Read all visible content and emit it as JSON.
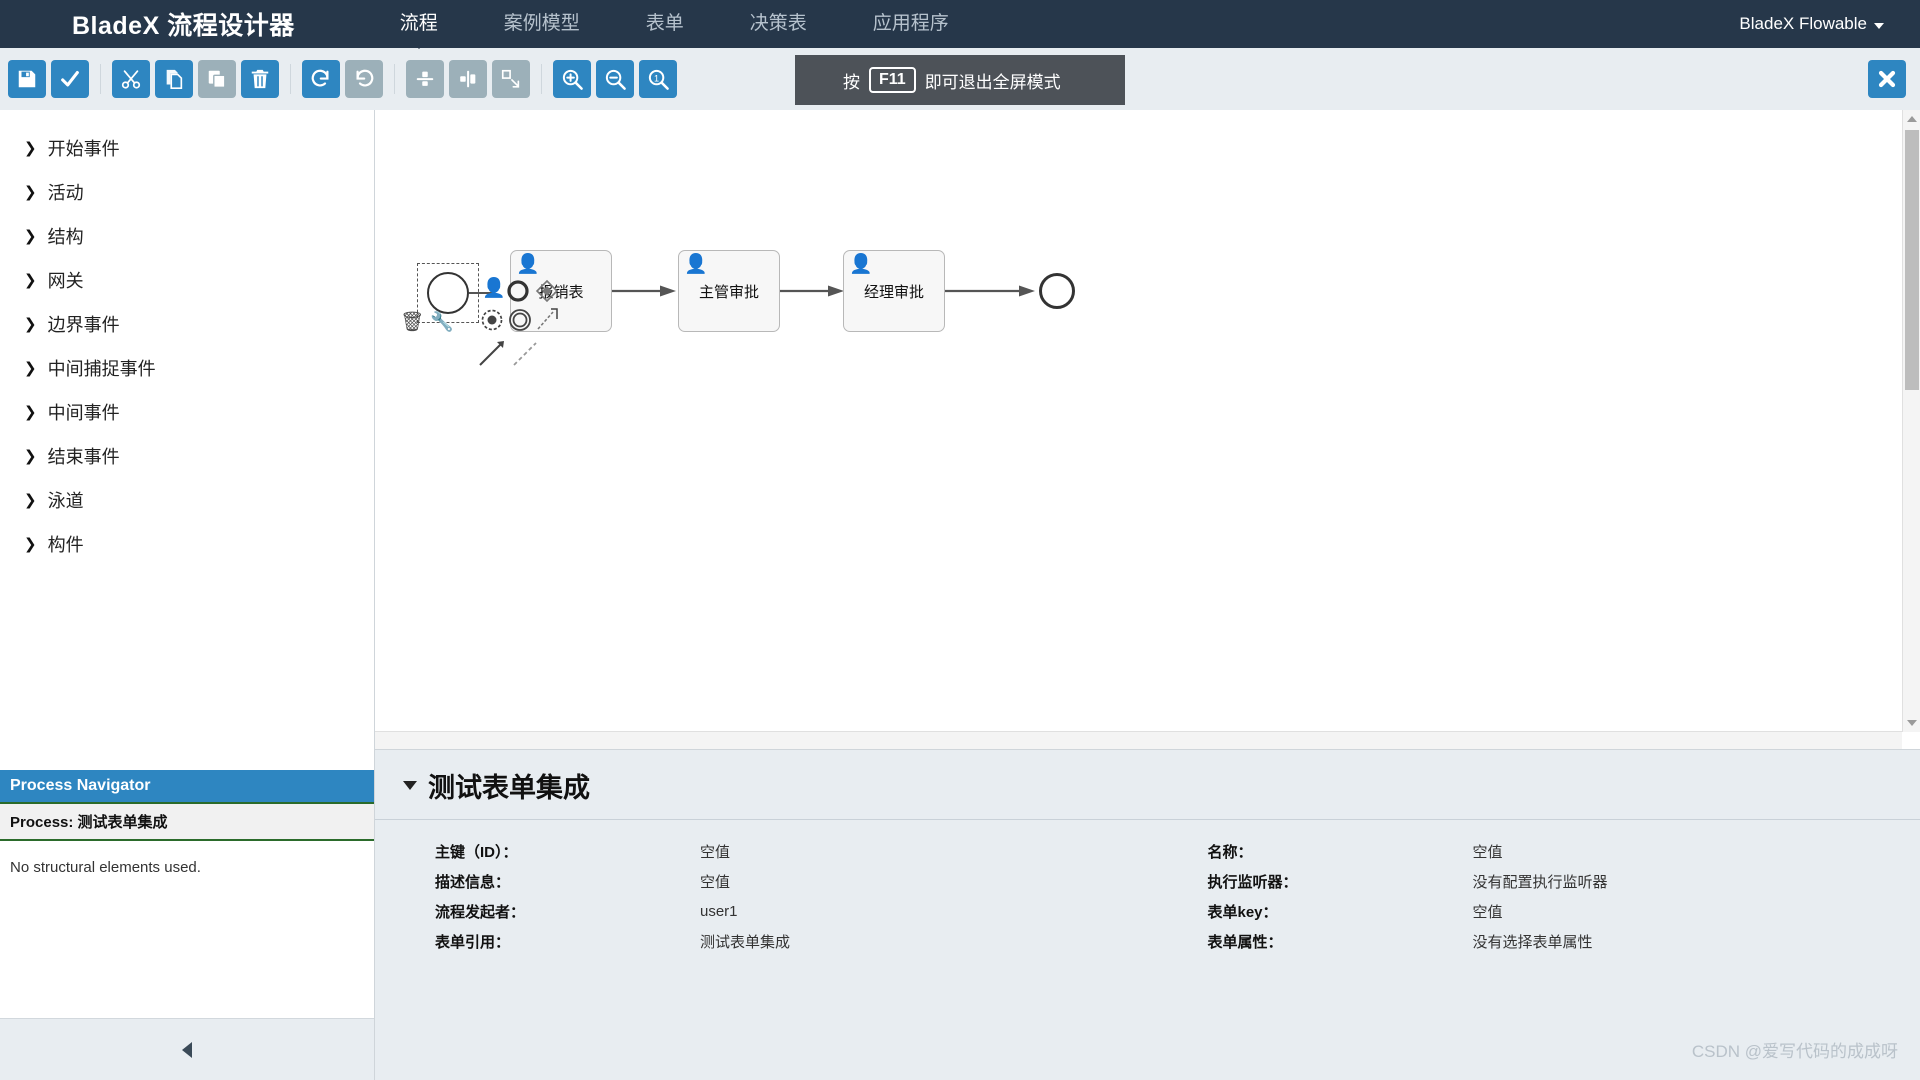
{
  "app": {
    "brand": "BladeX 流程设计器",
    "account": "BladeX Flowable"
  },
  "nav": {
    "tabs": [
      {
        "label": "流程",
        "active": true
      },
      {
        "label": "案例模型",
        "active": false
      },
      {
        "label": "表单",
        "active": false
      },
      {
        "label": "决策表",
        "active": false
      },
      {
        "label": "应用程序",
        "active": false
      }
    ]
  },
  "toolbar": {
    "buttons": [
      {
        "name": "save-button",
        "icon": "floppy-disk-icon",
        "enabled": true
      },
      {
        "name": "validate-button",
        "icon": "check-icon",
        "enabled": true
      },
      {
        "name": "cut-button",
        "icon": "scissors-icon",
        "enabled": true
      },
      {
        "name": "copy-button",
        "icon": "copy-icon",
        "enabled": true
      },
      {
        "name": "paste-button",
        "icon": "paste-icon",
        "enabled": false
      },
      {
        "name": "delete-button",
        "icon": "trash-icon",
        "enabled": true
      },
      {
        "name": "redo-button",
        "icon": "redo-icon",
        "enabled": true
      },
      {
        "name": "undo-button",
        "icon": "undo-icon",
        "enabled": false
      },
      {
        "name": "align-vertical-button",
        "icon": "align-vertical-icon",
        "enabled": false
      },
      {
        "name": "align-horizontal-button",
        "icon": "align-horizontal-icon",
        "enabled": false
      },
      {
        "name": "same-size-button",
        "icon": "resize-icon",
        "enabled": false
      },
      {
        "name": "zoom-in-button",
        "icon": "zoom-in-icon",
        "enabled": true
      },
      {
        "name": "zoom-out-button",
        "icon": "zoom-out-icon",
        "enabled": true
      },
      {
        "name": "zoom-reset-button",
        "icon": "zoom-actual-icon",
        "enabled": true
      }
    ],
    "close_label": "×"
  },
  "fullscreen_tip": {
    "prefix": "按",
    "key": "F11",
    "suffix": "即可退出全屏模式"
  },
  "palette": {
    "items": [
      {
        "label": "开始事件"
      },
      {
        "label": "活动"
      },
      {
        "label": "结构"
      },
      {
        "label": "网关"
      },
      {
        "label": "边界事件"
      },
      {
        "label": "中间捕捉事件"
      },
      {
        "label": "中间事件"
      },
      {
        "label": "结束事件"
      },
      {
        "label": "泳道"
      },
      {
        "label": "构件"
      }
    ]
  },
  "navigator": {
    "header": "Process Navigator",
    "process_label": "Process: 测试表单集成",
    "empty_text": "No structural elements used."
  },
  "diagram": {
    "start_event": {
      "name": "start-event",
      "label": ""
    },
    "tasks": [
      {
        "label": "填写报销表",
        "visible_label": "报销表",
        "type": "user-task"
      },
      {
        "label": "主管审批",
        "visible_label": "主管审批",
        "type": "user-task"
      },
      {
        "label": "经理审批",
        "visible_label": "经理审批",
        "type": "user-task"
      }
    ],
    "end_event": {
      "name": "end-event",
      "label": ""
    }
  },
  "properties": {
    "title": "测试表单集成",
    "left": [
      {
        "key": "主键（ID）：",
        "value": "空值"
      },
      {
        "key": "描述信息：",
        "value": "空值"
      },
      {
        "key": "流程发起者：",
        "value": "user1"
      },
      {
        "key": "表单引用：",
        "value": "测试表单集成"
      }
    ],
    "right": [
      {
        "key": "名称：",
        "value": "空值"
      },
      {
        "key": "执行监听器：",
        "value": "没有配置执行监听器"
      },
      {
        "key": "表单key：",
        "value": "空值"
      },
      {
        "key": "表单属性：",
        "value": "没有选择表单属性"
      }
    ]
  },
  "watermark": "CSDN @爱写代码的成成呀",
  "colors": {
    "nav_bg": "#26374a",
    "accent": "#2e86c1",
    "disabled": "#9cb0b9",
    "panel_bg": "#e8edf1",
    "navigator_border": "#2b6b2b"
  }
}
